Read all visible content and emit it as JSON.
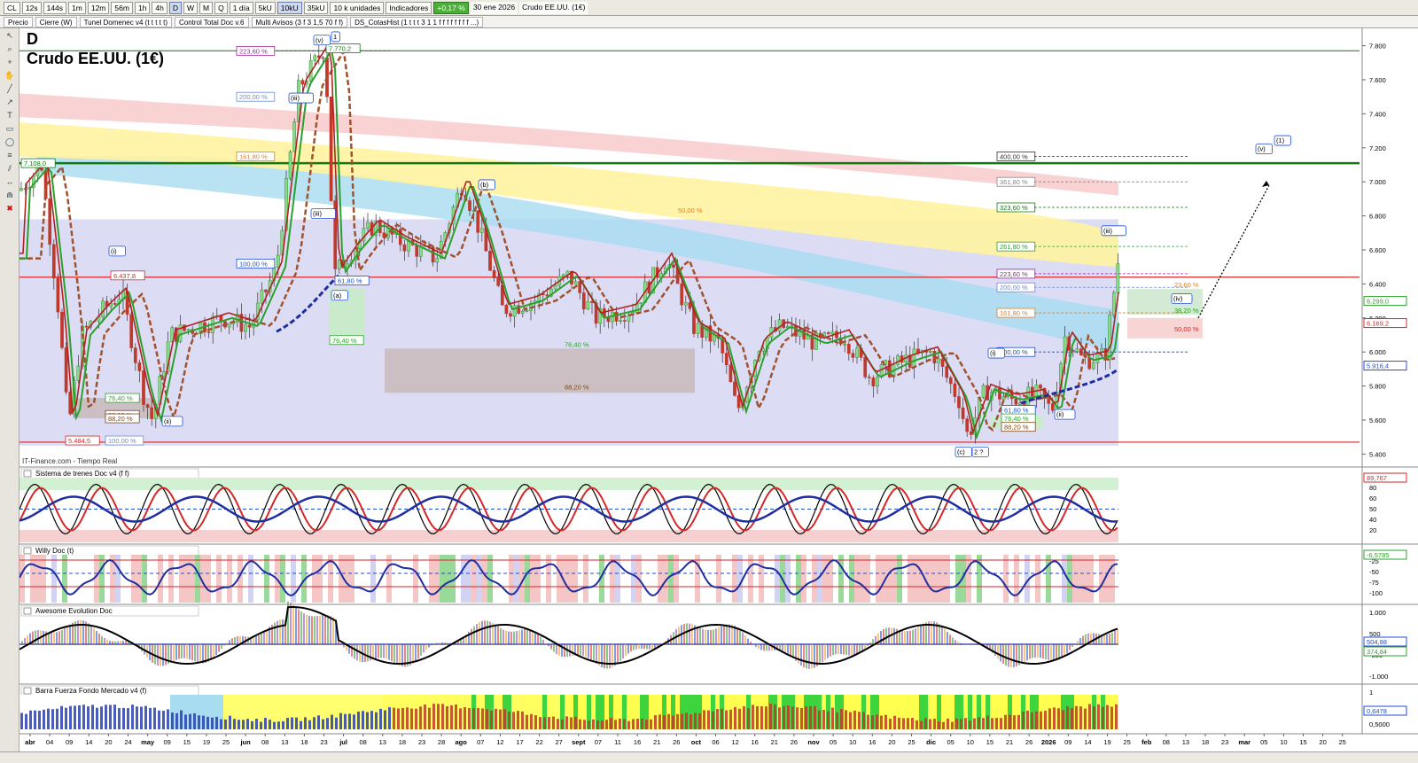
{
  "toolbar": {
    "symbol": "CL",
    "timeframes": [
      "12s",
      "144s",
      "1m",
      "12m",
      "56m",
      "1h",
      "4h",
      "D",
      "W",
      "M",
      "Q"
    ],
    "selected_timeframe": "D",
    "period": "1 día",
    "volume_buttons": [
      "5kU",
      "10kU",
      "35kU"
    ],
    "units": "10 k unidades",
    "indicators_label": "Indicadores",
    "change": "+0,17 %",
    "date": "30 ene 2026",
    "instrument": "Crudo EE.UU. (1€)"
  },
  "tabs": [
    "Precio",
    "Cierre (W)",
    "Tunel Domenec v4 (t t t t t)",
    "Control Total Doc v.6",
    "Multi Avisos (3 f 3 1,5 70 f f)",
    "DS_CotasHist (1 t t t 3 1 1 f f f f f f f f ...)"
  ],
  "chart": {
    "period_letter": "D",
    "title": "Crudo EE.UU. (1€)",
    "source": "IT-Finance.com - Tiempo Real",
    "price_ticks": [
      "7.800",
      "7.600",
      "7.400",
      "7.200",
      "7.000",
      "6.800",
      "6.600",
      "6.400",
      "6.200",
      "6.000",
      "5.800",
      "5.600",
      "5.400"
    ],
    "price_badges": [
      "6.299,0",
      "6.169,2",
      "5.916,4"
    ],
    "price_labels": [
      "7.108,0",
      "7.770,2",
      "5.484,5",
      "6.437,8"
    ],
    "fib_labels_left": [
      "223,60 %",
      "200,00 %",
      "161,80 %",
      "100,00 %",
      "61,80 %",
      "76,40 %",
      "88,20 %",
      "76,40 %",
      "88,20 %",
      "100,00 %"
    ],
    "fib_labels_mid": [
      "50,00 %",
      "76,40 %",
      "88,20 %"
    ],
    "fib_labels_right": [
      "400,00 %",
      "361,80 %",
      "323,60 %",
      "261,80 %",
      "223,60 %",
      "200,00 %",
      "161,80 %",
      "100,00 %",
      "61,80 %",
      "76,40 %",
      "88,20 %"
    ],
    "fib_labels_far": [
      "23,60 %",
      "38,20 %",
      "50,00 %"
    ],
    "wave_labels": [
      "(v)",
      "1",
      "(iii)",
      "(b)",
      "(a)",
      "(i)",
      "(ii)",
      "(iii)",
      "(iv)",
      "(v)",
      "(1)",
      "(c)",
      "2 ?",
      "(i)",
      "(ii)",
      "(iii)"
    ]
  },
  "panels": [
    {
      "title": "Sistema de trenes Doc v4 (f f)",
      "ticks": [
        "100",
        "80",
        "60",
        "50",
        "40",
        "20"
      ],
      "value": "89,767"
    },
    {
      "title": "Willy Doc (t)",
      "ticks": [
        "-25",
        "-50",
        "-75",
        "-100"
      ],
      "value": "-6,5785"
    },
    {
      "title": "Awesome Evolution Doc",
      "ticks": [
        "1.000",
        "500",
        "-500",
        "-1.000"
      ],
      "values": [
        "504,88",
        "374,84"
      ]
    },
    {
      "title": "Barra Fuerza Fondo Mercado v4 (f)",
      "ticks": [
        "1",
        "0,5000"
      ],
      "value": "0,6478"
    }
  ],
  "time_axis": [
    "abr",
    "04",
    "09",
    "14",
    "20",
    "24",
    "may",
    "09",
    "15",
    "19",
    "25",
    "jun",
    "08",
    "13",
    "18",
    "23",
    "jul",
    "08",
    "13",
    "18",
    "23",
    "28",
    "ago",
    "07",
    "12",
    "17",
    "22",
    "27",
    "sept",
    "07",
    "11",
    "16",
    "21",
    "26",
    "oct",
    "06",
    "12",
    "16",
    "21",
    "26",
    "nov",
    "05",
    "10",
    "16",
    "20",
    "25",
    "dic",
    "05",
    "10",
    "15",
    "21",
    "26",
    "2026",
    "09",
    "14",
    "19",
    "25",
    "feb",
    "08",
    "13",
    "18",
    "23",
    "mar",
    "05",
    "10",
    "15",
    "20",
    "25"
  ],
  "colors": {
    "accent": "#1e9c1e",
    "resistance": "#d62728",
    "support": "#1f4fd6"
  }
}
